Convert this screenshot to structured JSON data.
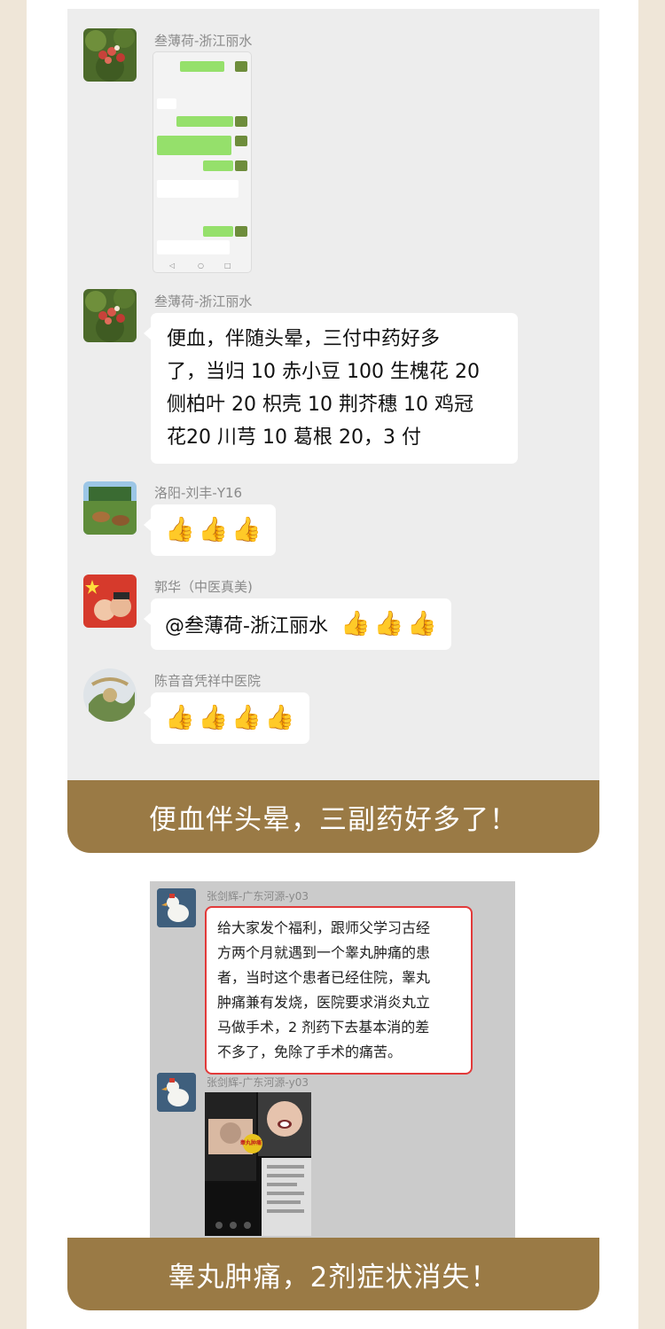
{
  "colors": {
    "page_bg": "#efe6d8",
    "chat_bg": "#ededed",
    "caption_bg": "#9a7a45",
    "highlight_border": "#e23a3a",
    "wechat_green": "#95e06b"
  },
  "card1": {
    "messages": [
      {
        "sender": "叁薄荷-浙江丽水",
        "type": "image"
      },
      {
        "sender": "叁薄荷-浙江丽水",
        "type": "text",
        "lines": [
          "便血，伴随头晕，三付中药好多",
          "了，当归 10 赤小豆 100 生槐花 20",
          "侧柏叶 20 枳壳 10 荆芥穗 10 鸡冠",
          "花20 川芎 10 葛根 20，3 付"
        ]
      },
      {
        "sender": "洛阳-刘丰-Y16",
        "type": "thumbs",
        "thumbs": [
          "👍",
          "👍",
          "👍"
        ]
      },
      {
        "sender": "郭华（中医真美)",
        "type": "mention",
        "mention": "@叁薄荷-浙江丽水",
        "thumbs": [
          "👍",
          "👍",
          "👍"
        ]
      },
      {
        "sender": "陈音音凭祥中医院",
        "type": "thumbs",
        "thumbs": [
          "👍",
          "👍",
          "👍",
          "👍"
        ]
      }
    ],
    "caption": "便血伴头晕，三副药好多了！"
  },
  "card2": {
    "messages": [
      {
        "sender": "张剑辉-广东河源-y03",
        "lines": [
          "给大家发个福利，跟师父学习古经",
          "方两个月就遇到一个睾丸肿痛的患",
          "者，当时这个患者已经住院，睾丸",
          "肿痛兼有发烧，医院要求消炎丸立",
          "马做手术，2 剂药下去基本消的差",
          "不多了，免除了手术的痛苦。"
        ]
      },
      {
        "sender": "张剑辉-广东河源-y03",
        "type": "image",
        "image_label": "睾丸肿痛"
      }
    ],
    "caption": "睾丸肿痛，2剂症状消失！"
  }
}
